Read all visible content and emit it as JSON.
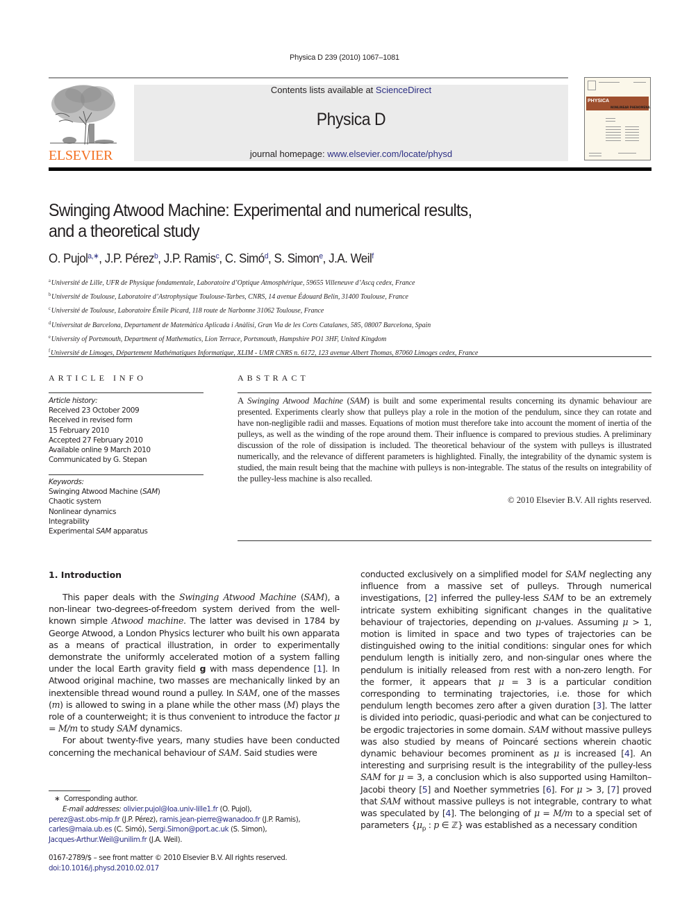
{
  "header": {
    "citation": "Physica D 239 (2010) 1067–1081",
    "contents_prefix": "Contents lists available at ",
    "contents_link": "ScienceDirect",
    "journal_title": "Physica D",
    "homepage_prefix": "journal homepage: ",
    "homepage_link": "www.elsevier.com/locate/physd",
    "publisher_logo_text": "ELSEVIER",
    "cover_band_text": "PHYSICA",
    "cover_subtitle": "NONLINEAR PHENOMENA",
    "colors": {
      "publisher_orange": "#f37021",
      "link_blue": "#2b2e83",
      "banner_gray": "#ebebeb",
      "cover_band": "#9e4f2e"
    }
  },
  "article": {
    "title_line1": "Swinging Atwood Machine: Experimental and numerical results,",
    "title_line2": "and a theoretical study",
    "authors": [
      {
        "name": "O. Pujol",
        "sup": "a,∗",
        "sep": ", "
      },
      {
        "name": "J.P. Pérez",
        "sup": "b",
        "sep": ", "
      },
      {
        "name": "J.P. Ramis",
        "sup": "c",
        "sep": ", "
      },
      {
        "name": "C. Simó",
        "sup": "d",
        "sep": ", "
      },
      {
        "name": "S. Simon",
        "sup": "e",
        "sep": ", "
      },
      {
        "name": "J.A. Weil",
        "sup": "f",
        "sep": ""
      }
    ],
    "affiliations": [
      {
        "label": "a",
        "text": "Université de Lille, UFR de Physique fondamentale, Laboratoire d’Optique Atmosphérique, 59655 Villeneuve d’Ascq cedex, France"
      },
      {
        "label": "b",
        "text": "Université de Toulouse, Laboratoire d’Astrophysique Toulouse-Tarbes, CNRS, 14 avenue Édouard Belin, 31400 Toulouse, France"
      },
      {
        "label": "c",
        "text": "Université de Toulouse, Laboratoire Émile Picard, 118 route de Narbonne 31062 Toulouse, France"
      },
      {
        "label": "d",
        "text": "Universitat de Barcelona, Departament de Matemàtica Aplicada i Anàlisi, Gran Via de les Corts Catalanes, 585, 08007 Barcelona, Spain"
      },
      {
        "label": "e",
        "text": "University of Portsmouth, Department of Mathematics, Lion Terrace, Portsmouth, Hampshire PO1 3HF, United Kingdom"
      },
      {
        "label": "f",
        "text": "Université de Limoges, Département Mathématiques Informatique, XLIM - UMR CNRS n. 6172, 123 avenue Albert Thomas, 87060 Limoges cedex, France"
      }
    ]
  },
  "article_info": {
    "heading": "ARTICLE INFO",
    "history_label": "Article history:",
    "history": [
      "Received 23 October 2009",
      "Received in revised form",
      "15 February 2010",
      "Accepted 27 February 2010",
      "Available online 9 March 2010",
      "Communicated by G. Stepan"
    ],
    "keywords_label": "Keywords:",
    "keywords": [
      {
        "pre": "Swinging Atwood Machine (",
        "it": "SAM",
        "post": ")"
      },
      {
        "pre": "Chaotic system",
        "it": "",
        "post": ""
      },
      {
        "pre": "Nonlinear dynamics",
        "it": "",
        "post": ""
      },
      {
        "pre": "Integrability",
        "it": "",
        "post": ""
      },
      {
        "pre": "Experimental ",
        "it": "SAM",
        "post": " apparatus"
      }
    ]
  },
  "abstract": {
    "heading": "ABSTRACT",
    "lead": "A ",
    "lead_italic": "Swinging Atwood Machine",
    "lead_mid": " (",
    "lead_sam": "SAM",
    "body": ") is built and some experimental results concerning its dynamic behaviour are presented. Experiments clearly show that pulleys play a role in the motion of the pendulum, since they can rotate and have non-negligible radii and masses. Equations of motion must therefore take into account the moment of inertia of the pulleys, as well as the winding of the rope around them. Their influence is compared to previous studies. A preliminary discussion of the role of dissipation is included. The theoretical behaviour of the system with pulleys is illustrated numerically, and the relevance of different parameters is highlighted. Finally, the integrability of the dynamic system is studied, the main result being that the machine with pulleys is non-integrable. The status of the results on integrability of the pulley-less machine is also recalled.",
    "copyright": "© 2010 Elsevier B.V. All rights reserved."
  },
  "introduction": {
    "heading": "1.  Introduction",
    "p1": [
      {
        "t": "This paper deals with the "
      },
      {
        "i": "Swinging Atwood Machine"
      },
      {
        "t": " ("
      },
      {
        "i": "SAM"
      },
      {
        "t": "), a non-linear two-degrees-of-freedom system derived from the well-known simple "
      },
      {
        "i": "Atwood machine"
      },
      {
        "t": ". The latter was devised in 1784 by George Atwood, a London Physics lecturer who built his own apparata as a means of practical illustration, in order to experimentally demonstrate the uniformly accelerated motion of a system falling under the local Earth gravity field "
      },
      {
        "b": "g"
      },
      {
        "t": " with mass dependence ["
      },
      {
        "l": "1"
      },
      {
        "t": "]. In Atwood original machine, two masses are mechanically linked by an inextensible thread wound round a pulley. In "
      },
      {
        "i": "SAM"
      },
      {
        "t": ", one of the masses ("
      },
      {
        "i": "m"
      },
      {
        "t": ") is allowed to swing in a plane while the other mass ("
      },
      {
        "i": "M"
      },
      {
        "t": ") plays the role of a counterweight; it is thus convenient to introduce the factor "
      },
      {
        "i": "μ"
      },
      {
        "t": " = "
      },
      {
        "i": "M/m"
      },
      {
        "t": " to study "
      },
      {
        "i": "SAM"
      },
      {
        "t": " dynamics."
      }
    ],
    "p2": [
      {
        "t": "For about twenty-five years, many studies have been conducted concerning the mechanical behaviour of "
      },
      {
        "i": "SAM"
      },
      {
        "t": ". Said studies were"
      }
    ],
    "p3": [
      {
        "t": "conducted exclusively on a simplified model for "
      },
      {
        "i": "SAM"
      },
      {
        "t": " neglecting any influence from a massive set of pulleys. Through numerical investigations, ["
      },
      {
        "l": "2"
      },
      {
        "t": "] inferred the pulley-less "
      },
      {
        "i": "SAM"
      },
      {
        "t": " to be an extremely intricate system exhibiting significant changes in the qualitative behaviour of trajectories, depending on "
      },
      {
        "i": "μ"
      },
      {
        "t": "-values. Assuming "
      },
      {
        "i": "μ"
      },
      {
        "t": " > 1, motion is limited in space and two types of trajectories can be distinguished owing to the initial conditions: singular ones for which pendulum length is initially zero, and non-singular ones where the pendulum is initially released from rest with a non-zero length. For the former, it appears that "
      },
      {
        "i": "μ"
      },
      {
        "t": " = 3 is a particular condition corresponding to terminating trajectories, i.e. those for which pendulum length becomes zero after a given duration ["
      },
      {
        "l": "3"
      },
      {
        "t": "]. The latter is divided into periodic, quasi-periodic and what can be conjectured to be ergodic trajectories in some domain. "
      },
      {
        "i": "SAM"
      },
      {
        "t": " without massive pulleys was also studied by means of Poincaré sections wherein chaotic dynamic behaviour becomes prominent as "
      },
      {
        "i": "μ"
      },
      {
        "t": " is increased ["
      },
      {
        "l": "4"
      },
      {
        "t": "]. An interesting and surprising result is the integrability of the pulley-less "
      },
      {
        "i": "SAM"
      },
      {
        "t": " for "
      },
      {
        "i": "μ"
      },
      {
        "t": " = 3, a conclusion which is also supported using Hamilton–Jacobi theory ["
      },
      {
        "l": "5"
      },
      {
        "t": "] and Noether symmetries ["
      },
      {
        "l": "6"
      },
      {
        "t": "]. For "
      },
      {
        "i": "μ"
      },
      {
        "t": " > 3, ["
      },
      {
        "l": "7"
      },
      {
        "t": "] proved that "
      },
      {
        "i": "SAM"
      },
      {
        "t": " without massive pulleys is not integrable, contrary to what was speculated by ["
      },
      {
        "l": "4"
      },
      {
        "t": "]. The belonging of "
      },
      {
        "i": "μ"
      },
      {
        "t": " = "
      },
      {
        "i": "M/m"
      },
      {
        "t": " to a special set of parameters {"
      },
      {
        "i": "μ"
      },
      {
        "s": "p"
      },
      {
        "t": " : "
      },
      {
        "i": "p"
      },
      {
        "t": " ∈ ℤ} was established as a necessary condition"
      }
    ]
  },
  "footnotes": {
    "star": "∗",
    "corresponding": "Corresponding author.",
    "email_label": "E-mail addresses:",
    "emails": [
      {
        "addr": "olivier.pujol@loa.univ-lille1.fr",
        "who": " (O. Pujol),"
      },
      {
        "addr": "perez@ast.obs-mip.fr",
        "who": " (J.P. Pérez), "
      },
      {
        "addr": "ramis.jean-pierre@wanadoo.fr",
        "who": " (J.P. Ramis),"
      },
      {
        "addr": "carles@maia.ub.es",
        "who": " (C. Simó), "
      },
      {
        "addr": "Sergi.Simon@port.ac.uk",
        "who": " (S. Simon),"
      },
      {
        "addr": "Jacques-Arthur.Weil@unilim.fr",
        "who": " (J.A. Weil)."
      }
    ],
    "front_matter": "0167-2789/$ – see front matter © 2010 Elsevier B.V. All rights reserved.",
    "doi": "doi:10.1016/j.physd.2010.02.017"
  }
}
